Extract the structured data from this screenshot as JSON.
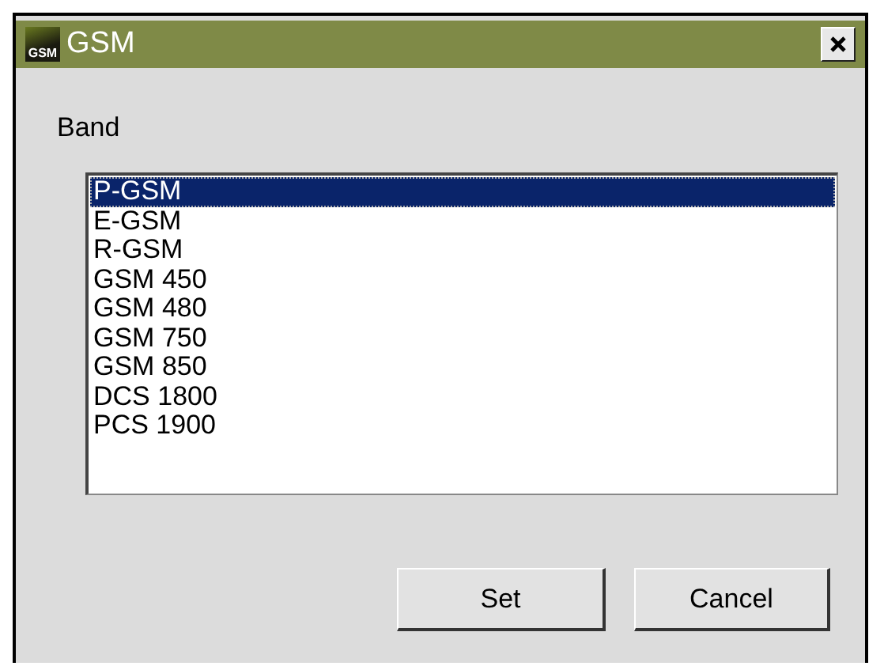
{
  "window": {
    "title": "GSM",
    "icon_text": "GSM"
  },
  "band": {
    "label": "Band",
    "options": [
      {
        "label": "P-GSM",
        "selected": true
      },
      {
        "label": "E-GSM",
        "selected": false
      },
      {
        "label": "R-GSM",
        "selected": false
      },
      {
        "label": "GSM 450",
        "selected": false
      },
      {
        "label": "GSM 480",
        "selected": false
      },
      {
        "label": "GSM 750",
        "selected": false
      },
      {
        "label": "GSM 850",
        "selected": false
      },
      {
        "label": "DCS 1800",
        "selected": false
      },
      {
        "label": "PCS 1900",
        "selected": false
      }
    ]
  },
  "buttons": [
    "Set",
    "Cancel"
  ]
}
